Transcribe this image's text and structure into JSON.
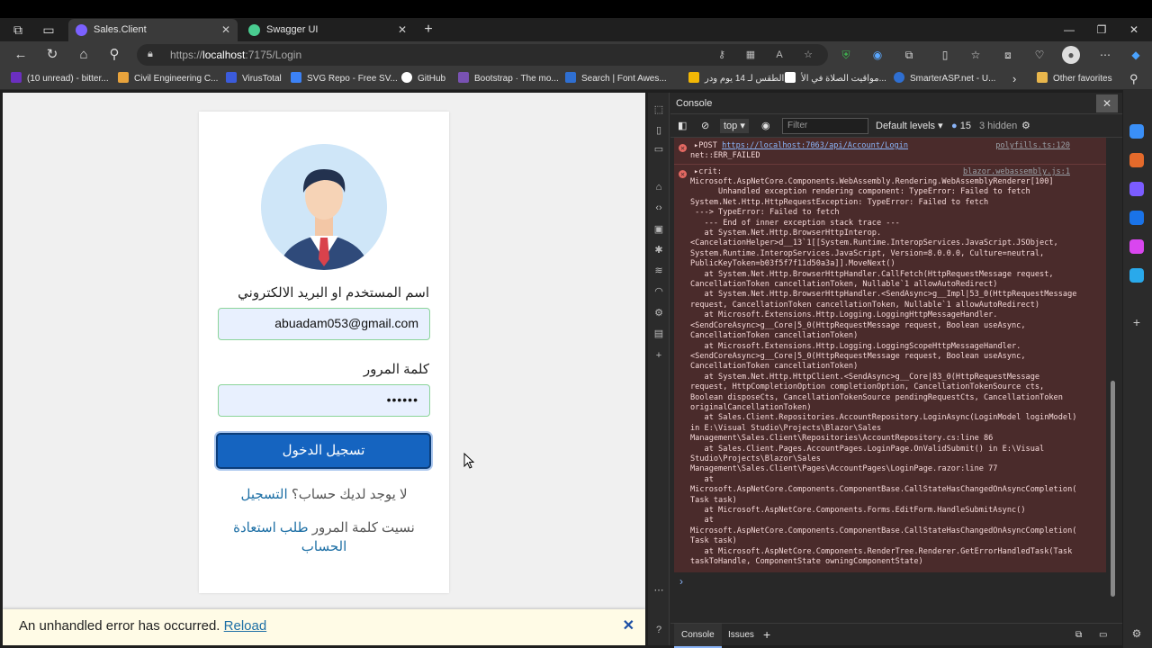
{
  "tabs": [
    {
      "label": "Sales.Client",
      "close": "✕"
    },
    {
      "label": "Swagger UI",
      "close": "✕"
    }
  ],
  "new_tab": "+",
  "window_controls": {
    "minimize": "—",
    "restore": "❐",
    "close": "✕"
  },
  "address": {
    "protocol": "https://",
    "host": "localhost",
    "path": ":7175/Login"
  },
  "bookmarks": [
    {
      "label": "(10 unread) - bitter...",
      "color": "#6b2fbf"
    },
    {
      "label": "Civil Engineering C...",
      "color": "#e8a33c"
    },
    {
      "label": "VirusTotal",
      "color": "#3b5bdb"
    },
    {
      "label": "SVG Repo - Free SV...",
      "color": "#3c82f6"
    },
    {
      "label": "GitHub",
      "color": "#ffffff"
    },
    {
      "label": "Bootstrap · The mo...",
      "color": "#7952b3"
    },
    {
      "label": "Search | Font Awes...",
      "color": "#2f6fd1"
    },
    {
      "label": "الطقس لـ 14 يوم ودر...",
      "color": "#f2b705"
    },
    {
      "label": "مواقيت الصلاة في الأ...",
      "color": "#ffffff"
    },
    {
      "label": "SmarterASP.net - U...",
      "color": "#2f6fd1"
    }
  ],
  "bookmarks_more": "›",
  "other_favorites": "Other favorites",
  "login": {
    "username_label": "اسم المستخدم او البريد الالكتروني",
    "username_value": "abuadam053@gmail.com",
    "password_label": "كلمة المرور",
    "password_value": "••••••",
    "login_button": "تسجيل الدخول",
    "no_account_text": "لا يوجد لديك حساب؟",
    "register_link": "التسجيل",
    "forgot_text": "نسيت كلمة المرور",
    "recover_link": "طلب استعادة",
    "recover_link_2": "الحساب"
  },
  "error_bar": {
    "message": "An unhandled error has occurred.",
    "reload": "Reload",
    "close": "✕"
  },
  "devtools": {
    "title": "Console",
    "context": "top",
    "filter_placeholder": "Filter",
    "levels": "Default levels",
    "issues_count": "15",
    "hidden": "3 hidden",
    "entries": [
      {
        "method": "POST",
        "url": "https://localhost:7063/api/Account/Login",
        "source": "polyfills.ts:120",
        "detail": "net::ERR_FAILED"
      },
      {
        "head": "crit:",
        "source": "blazor.webassembly.js:1",
        "detail": "Microsoft.AspNetCore.Components.WebAssembly.Rendering.WebAssemblyRenderer[100]\n      Unhandled exception rendering component: TypeError: Failed to fetch\nSystem.Net.Http.HttpRequestException: TypeError: Failed to fetch\n ---> TypeError: Failed to fetch\n   --- End of inner exception stack trace ---\n   at System.Net.Http.BrowserHttpInterop.\n<CancelationHelper>d__13`1[[System.Runtime.InteropServices.JavaScript.JSObject,\nSystem.Runtime.InteropServices.JavaScript, Version=8.0.0.0, Culture=neutral,\nPublicKeyToken=b03f5f7f11d50a3a]].MoveNext()\n   at System.Net.Http.BrowserHttpHandler.CallFetch(HttpRequestMessage request,\nCancellationToken cancellationToken, Nullable`1 allowAutoRedirect)\n   at System.Net.Http.BrowserHttpHandler.<SendAsync>g__Impl|53_0(HttpRequestMessage\nrequest, CancellationToken cancellationToken, Nullable`1 allowAutoRedirect)\n   at Microsoft.Extensions.Http.Logging.LoggingHttpMessageHandler.\n<SendCoreAsync>g__Core|5_0(HttpRequestMessage request, Boolean useAsync,\nCancellationToken cancellationToken)\n   at Microsoft.Extensions.Http.Logging.LoggingScopeHttpMessageHandler.\n<SendCoreAsync>g__Core|5_0(HttpRequestMessage request, Boolean useAsync,\nCancellationToken cancellationToken)\n   at System.Net.Http.HttpClient.<SendAsync>g__Core|83_0(HttpRequestMessage\nrequest, HttpCompletionOption completionOption, CancellationTokenSource cts,\nBoolean disposeCts, CancellationTokenSource pendingRequestCts, CancellationToken\noriginalCancellationToken)\n   at Sales.Client.Repositories.AccountRepository.LoginAsync(LoginModel loginModel)\nin E:\\Visual Studio\\Projects\\Blazor\\Sales\nManagement\\Sales.Client\\Repositories\\AccountRepository.cs:line 86\n   at Sales.Client.Pages.AccountPages.LoginPage.OnValidSubmit() in E:\\Visual\nStudio\\Projects\\Blazor\\Sales\nManagement\\Sales.Client\\Pages\\AccountPages\\LoginPage.razor:line 77\n   at\nMicrosoft.AspNetCore.Components.ComponentBase.CallStateHasChangedOnAsyncCompletion(\nTask task)\n   at Microsoft.AspNetCore.Components.Forms.EditForm.HandleSubmitAsync()\n   at\nMicrosoft.AspNetCore.Components.ComponentBase.CallStateHasChangedOnAsyncCompletion(\nTask task)\n   at Microsoft.AspNetCore.Components.RenderTree.Renderer.GetErrorHandledTask(Task\ntaskToHandle, ComponentState owningComponentState)"
      }
    ],
    "prompt": "›",
    "bottom_tabs": [
      "Console",
      "Issues"
    ],
    "add_tab": "+"
  },
  "icons": [
    "workspaces-icon",
    "tab-actions-icon",
    "back-icon",
    "refresh-icon",
    "home-icon",
    "search-icon",
    "lock-icon",
    "settings-icon"
  ]
}
